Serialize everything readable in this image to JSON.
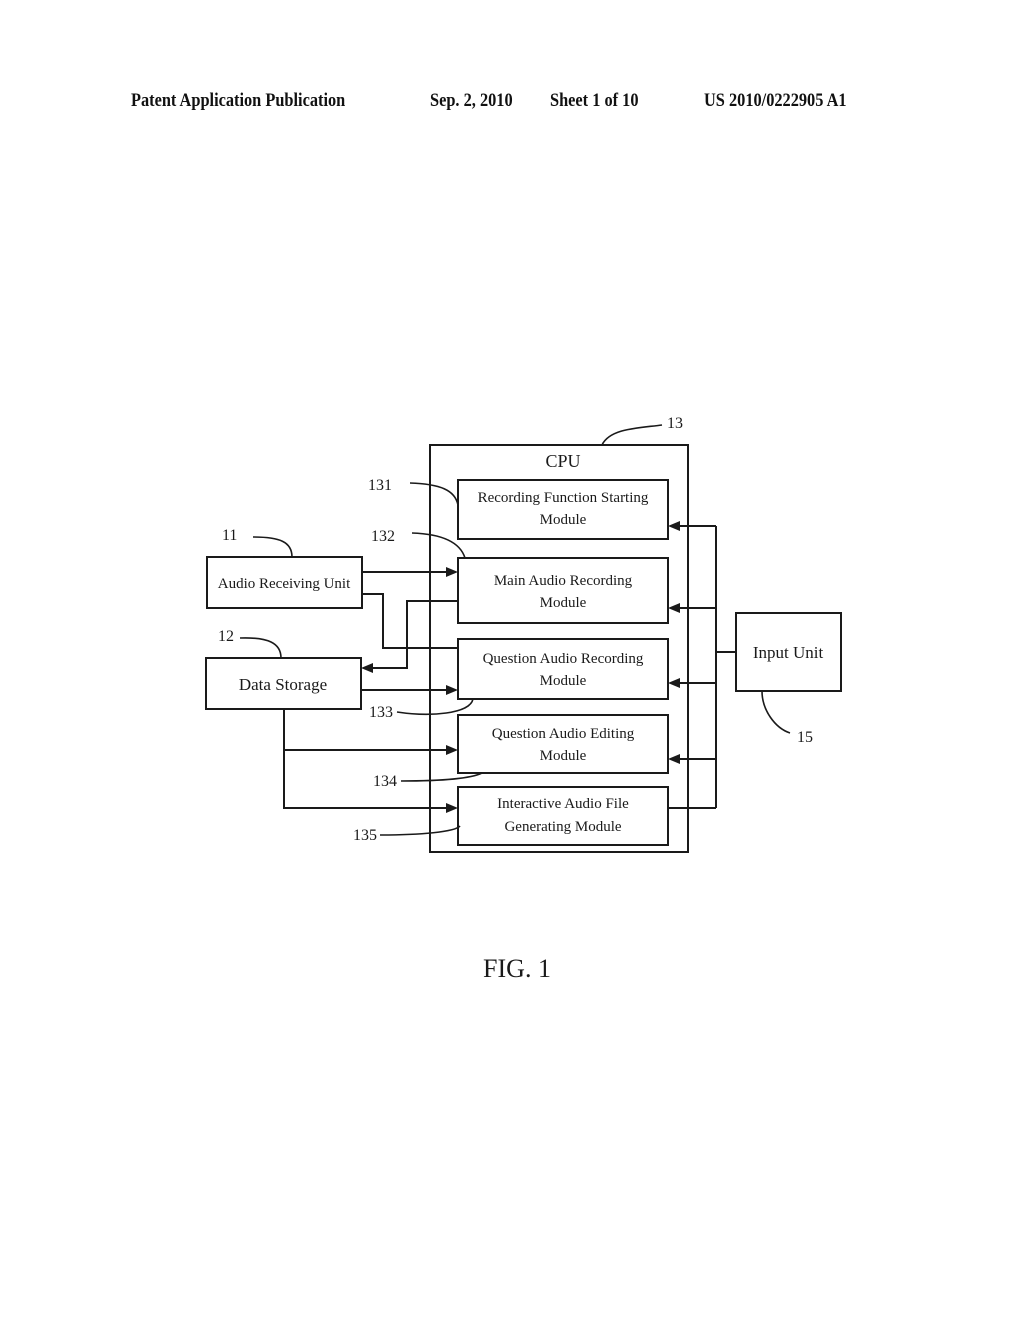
{
  "header": {
    "publication": "Patent Application Publication",
    "date": "Sep. 2, 2010",
    "sheet": "Sheet 1 of 10",
    "number": "US 2010/0222905 A1"
  },
  "diagram": {
    "cpu": {
      "label": "CPU",
      "ref": "13"
    },
    "modules": [
      {
        "ref": "131",
        "line1": "Recording Function Starting",
        "line2": "Module"
      },
      {
        "ref": "132",
        "line1": "Main Audio Recording",
        "line2": "Module"
      },
      {
        "ref": "133",
        "line1": "Question Audio Recording",
        "line2": "Module"
      },
      {
        "ref": "134",
        "line1": "Question Audio Editing",
        "line2": "Module"
      },
      {
        "ref": "135",
        "line1": "Interactive Audio File",
        "line2": "Generating Module"
      }
    ],
    "audio_receiving_unit": {
      "label": "Audio Receiving Unit",
      "ref": "11"
    },
    "data_storage": {
      "label": "Data Storage",
      "ref": "12"
    },
    "input_unit": {
      "label": "Input Unit",
      "ref": "15"
    }
  },
  "caption": "FIG. 1"
}
